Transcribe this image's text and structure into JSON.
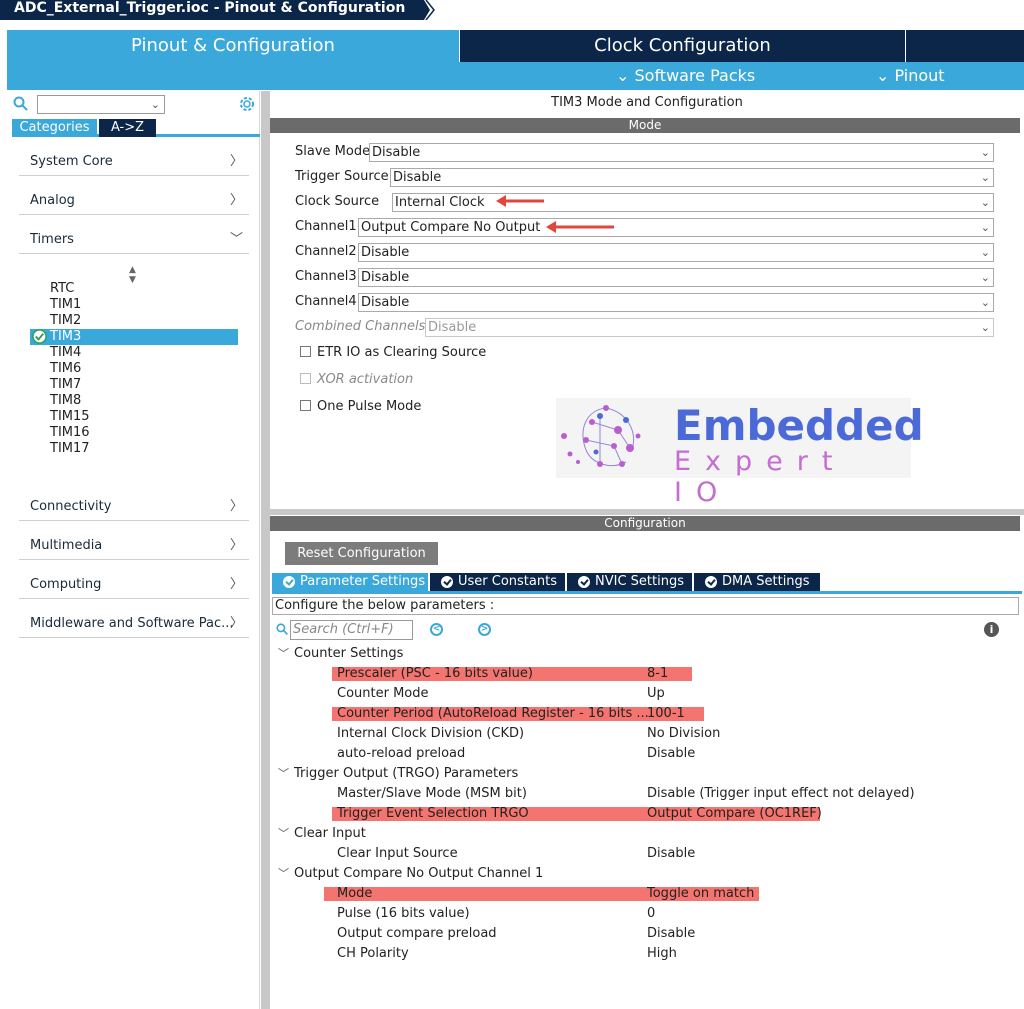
{
  "window": {
    "title": "ADC_External_Trigger.ioc - Pinout & Configuration"
  },
  "main_tabs": {
    "pinout": "Pinout & Configuration",
    "clock": "Clock Configuration"
  },
  "subbar": {
    "software_packs": "⌄ Software Packs",
    "pinout": "⌄ Pinout"
  },
  "left": {
    "category_tab": "Categories",
    "az_tab": "A->Z",
    "categories": [
      "System Core",
      "Analog",
      "Timers",
      "Connectivity",
      "Multimedia",
      "Computing",
      "Middleware and Software Pac..."
    ],
    "timers": [
      "RTC",
      "TIM1",
      "TIM2",
      "TIM3",
      "TIM4",
      "TIM6",
      "TIM7",
      "TIM8",
      "TIM15",
      "TIM16",
      "TIM17"
    ]
  },
  "mode": {
    "title": "TIM3 Mode and Configuration",
    "bar": "Mode",
    "rows": [
      {
        "label": "Slave Mode",
        "value": "Disable"
      },
      {
        "label": "Trigger Source",
        "value": "Disable"
      },
      {
        "label": "Clock Source",
        "value": "Internal Clock"
      },
      {
        "label": "Channel1",
        "value": "Output Compare No Output"
      },
      {
        "label": "Channel2",
        "value": "Disable"
      },
      {
        "label": "Channel3",
        "value": "Disable"
      },
      {
        "label": "Channel4",
        "value": "Disable"
      },
      {
        "label": "Combined Channels",
        "value": "Disable"
      }
    ],
    "checkboxes": [
      "ETR IO as Clearing Source",
      "XOR activation",
      "One Pulse Mode"
    ],
    "logo": {
      "line1": "Embedded",
      "line2": "Expert IO"
    }
  },
  "config": {
    "bar": "Configuration",
    "reset_label": "Reset Configuration",
    "tabs": [
      "Parameter Settings",
      "User Constants",
      "NVIC Settings",
      "DMA Settings"
    ],
    "desc": "Configure the below parameters :",
    "search_placeholder": "Search (Ctrl+F)",
    "groups": [
      {
        "name": "Counter Settings",
        "params": [
          {
            "name": "Prescaler (PSC - 16 bits value)",
            "value": "8-1"
          },
          {
            "name": "Counter Mode",
            "value": "Up"
          },
          {
            "name": "Counter Period (AutoReload Register - 16 bits ...",
            "value": "100-1"
          },
          {
            "name": "Internal Clock Division (CKD)",
            "value": "No Division"
          },
          {
            "name": "auto-reload preload",
            "value": "Disable"
          }
        ]
      },
      {
        "name": "Trigger Output (TRGO) Parameters",
        "params": [
          {
            "name": "Master/Slave Mode (MSM bit)",
            "value": "Disable (Trigger input effect not delayed)"
          },
          {
            "name": "Trigger Event Selection TRGO",
            "value": "Output Compare (OC1REF)"
          }
        ]
      },
      {
        "name": "Clear Input",
        "params": [
          {
            "name": "Clear Input Source",
            "value": "Disable"
          }
        ]
      },
      {
        "name": "Output Compare No Output Channel 1",
        "params": [
          {
            "name": "Mode",
            "value": "Toggle on match"
          },
          {
            "name": "Pulse (16 bits value)",
            "value": "0"
          },
          {
            "name": "Output compare preload",
            "value": "Disable"
          },
          {
            "name": "CH Polarity",
            "value": "High"
          }
        ]
      }
    ]
  },
  "colors": {
    "accent": "#3aa8db",
    "navy": "#0b2648",
    "highlight": "#f47470",
    "arrow": "#e0473d"
  }
}
